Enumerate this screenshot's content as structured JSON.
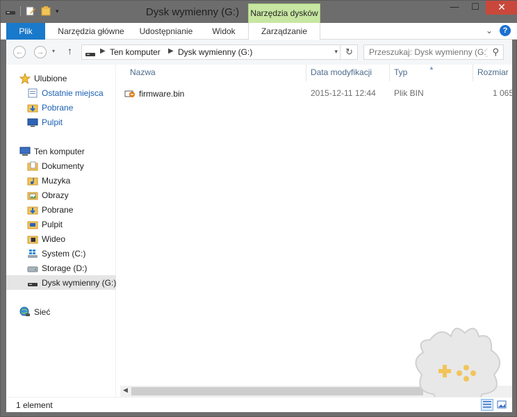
{
  "window": {
    "title": "Dysk wymienny (G:)",
    "context_tab": "Narzędzia dysków",
    "controls": {
      "minimize": "—",
      "maximize": "☐",
      "close": "✕"
    }
  },
  "ribbon": {
    "file_tab": "Plik",
    "tabs": [
      "Narzędzia główne",
      "Udostępnianie",
      "Widok",
      "Zarządzanie"
    ],
    "active_tab": "Zarządzanie",
    "expand_glyph": "⌄",
    "help_glyph": "?"
  },
  "navigation": {
    "back_glyph": "←",
    "forward_glyph": "→",
    "up_glyph": "↑",
    "address_crumbs": [
      "Ten komputer",
      "Dysk wymienny (G:)"
    ],
    "search_placeholder": "Przeszukaj: Dysk wymienny (G:)"
  },
  "nav_pane": {
    "favorites_label": "Ulubione",
    "favorites": [
      "Ostatnie miejsca",
      "Pobrane",
      "Pulpit"
    ],
    "computer_label": "Ten komputer",
    "computer_items": [
      "Dokumenty",
      "Muzyka",
      "Obrazy",
      "Pobrane",
      "Pulpit",
      "Wideo",
      "System (C:)",
      "Storage (D:)",
      "Dysk wymienny (G:)"
    ],
    "network_label": "Sieć",
    "selected": "Dysk wymienny (G:)"
  },
  "file_list": {
    "columns": [
      "Nazwa",
      "Data modyfikacji",
      "Typ",
      "Rozmiar"
    ],
    "sorted_column": "Typ",
    "rows": [
      {
        "name": "firmware.bin",
        "date": "2015-12-11 12:44",
        "type": "Plik BIN",
        "size": "1 065"
      }
    ]
  },
  "status": {
    "item_count": "1 element"
  },
  "colors": {
    "accent": "#1979ca",
    "context_tab": "#c7e6a2",
    "close_button": "#c9483b",
    "link": "#1a5fb4",
    "frame": "#6d6d6d"
  }
}
